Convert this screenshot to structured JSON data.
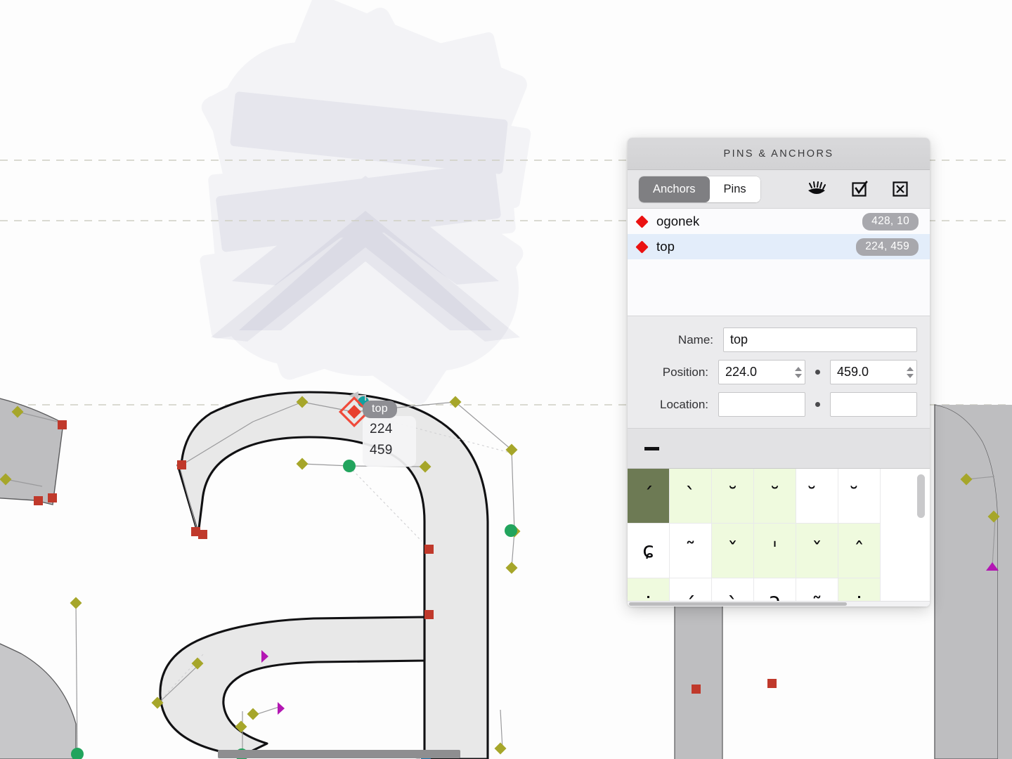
{
  "panel": {
    "title": "PINS & ANCHORS",
    "tabs": [
      {
        "label": "Anchors",
        "active": true
      },
      {
        "label": "Pins",
        "active": false
      }
    ],
    "toolbar_icons": [
      "eye-icon",
      "checkbox-checked-icon",
      "close-box-icon"
    ],
    "anchors": [
      {
        "name": "ogonek",
        "coords": "428, 10",
        "selected": false
      },
      {
        "name": "top",
        "coords": "224, 459",
        "selected": true
      }
    ],
    "form": {
      "name_label": "Name:",
      "name_value": "top",
      "position_label": "Position:",
      "position_x": "224.0",
      "position_y": "459.0",
      "location_label": "Location:",
      "location_x": "",
      "location_y": ""
    },
    "remove_button": "minus-icon",
    "glyph_grid": {
      "cells": [
        {
          "glyph": "ˊ",
          "tint": "selected"
        },
        {
          "glyph": "ˋ",
          "tint": "green"
        },
        {
          "glyph": "˘",
          "tint": "green"
        },
        {
          "glyph": "˘",
          "tint": "green"
        },
        {
          "glyph": "̆",
          "tint": "none"
        },
        {
          "glyph": "̆",
          "tint": "none"
        },
        {
          "glyph": "ɕ",
          "tint": "none"
        },
        {
          "glyph": "˜",
          "tint": "none"
        },
        {
          "glyph": "ˇ",
          "tint": "green"
        },
        {
          "glyph": "ˈ",
          "tint": "green"
        },
        {
          "glyph": "ˇ",
          "tint": "green"
        },
        {
          "glyph": "ˆ",
          "tint": "green"
        },
        {
          "glyph": "˙",
          "tint": "green"
        },
        {
          "glyph": "ˊ",
          "tint": "none"
        },
        {
          "glyph": "ˋ",
          "tint": "none"
        },
        {
          "glyph": "ʔ",
          "tint": "none"
        },
        {
          "glyph": "˜",
          "tint": "none"
        },
        {
          "glyph": "˙",
          "tint": "green"
        }
      ]
    }
  },
  "canvas": {
    "tooltip": {
      "label": "top",
      "x_value": "224",
      "y_value": "459"
    },
    "colors": {
      "anchor_red": "#eb1111",
      "node_red": "#c0392b",
      "handle_olive": "#a6a62a",
      "smooth_green": "#22a45d",
      "smooth_magenta": "#b317b3",
      "node_blue": "#1a73a8",
      "node_teal": "#12a0a0",
      "outline": "#111113",
      "fill_gray": "#c9c9cb",
      "fill_light": "#e7e7e7",
      "guide": "#cfcfc8"
    },
    "guides": [
      "x-height-guide",
      "ascender-guide",
      "cap-height-guide"
    ]
  }
}
